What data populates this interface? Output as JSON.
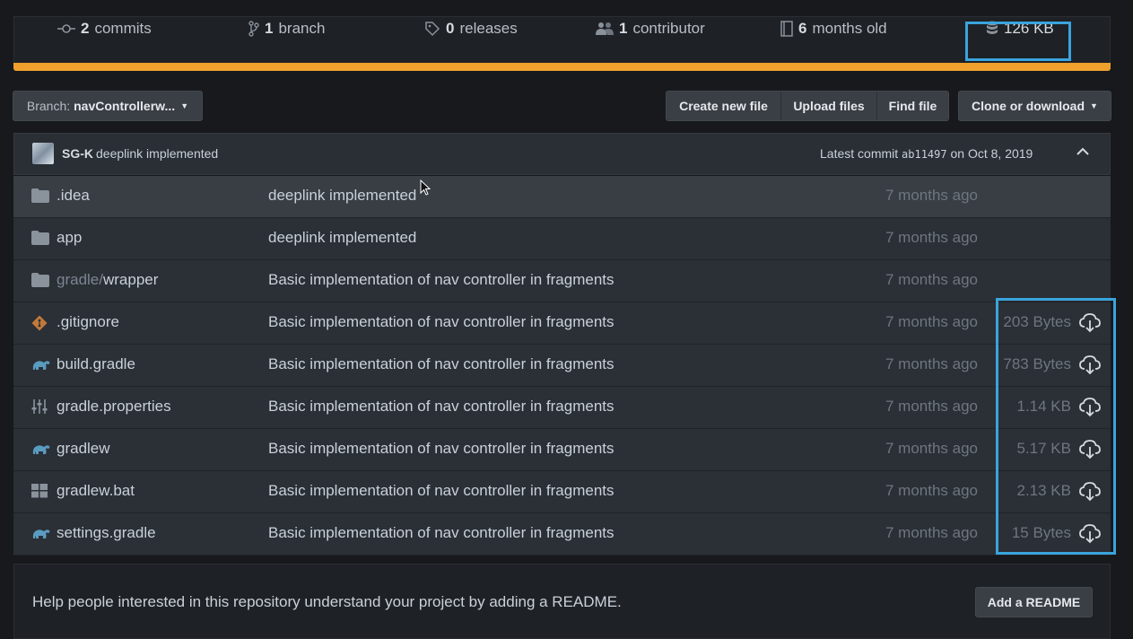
{
  "summary": {
    "commits_count": "2",
    "commits_label": "commits",
    "branch_count": "1",
    "branch_label": "branch",
    "releases_count": "0",
    "releases_label": "releases",
    "contributor_count": "1",
    "contributor_label": "contributor",
    "age_count": "6",
    "age_label": "months old",
    "size": "126 KB"
  },
  "toolbar": {
    "branch_prefix": "Branch:",
    "branch_name": "navControllerw...",
    "create_new_file": "Create new file",
    "upload_files": "Upload files",
    "find_file": "Find file",
    "clone_or_download": "Clone or download"
  },
  "commit": {
    "author": "SG-K",
    "message": "deeplink implemented",
    "latest_label": "Latest commit",
    "sha": "ab11497",
    "date": "on Oct 8, 2019"
  },
  "files": [
    {
      "icon": "folder-icon",
      "name_dim": "",
      "name": ".idea",
      "message": "deeplink implemented",
      "age": "7 months ago",
      "size": ""
    },
    {
      "icon": "folder-icon",
      "name_dim": "",
      "name": "app",
      "message": "deeplink implemented",
      "age": "7 months ago",
      "size": ""
    },
    {
      "icon": "folder-icon",
      "name_dim": "gradle/",
      "name": "wrapper",
      "message": "Basic implementation of nav controller in fragments",
      "age": "7 months ago",
      "size": ""
    },
    {
      "icon": "git-icon",
      "name_dim": "",
      "name": ".gitignore",
      "message": "Basic implementation of nav controller in fragments",
      "age": "7 months ago",
      "size": "203 Bytes"
    },
    {
      "icon": "gradle-icon",
      "name_dim": "",
      "name": "build.gradle",
      "message": "Basic implementation of nav controller in fragments",
      "age": "7 months ago",
      "size": "783 Bytes"
    },
    {
      "icon": "settings-sliders-icon",
      "name_dim": "",
      "name": "gradle.properties",
      "message": "Basic implementation of nav controller in fragments",
      "age": "7 months ago",
      "size": "1.14 KB"
    },
    {
      "icon": "gradle-icon",
      "name_dim": "",
      "name": "gradlew",
      "message": "Basic implementation of nav controller in fragments",
      "age": "7 months ago",
      "size": "5.17 KB"
    },
    {
      "icon": "windows-icon",
      "name_dim": "",
      "name": "gradlew.bat",
      "message": "Basic implementation of nav controller in fragments",
      "age": "7 months ago",
      "size": "2.13 KB"
    },
    {
      "icon": "gradle-icon",
      "name_dim": "",
      "name": "settings.gradle",
      "message": "Basic implementation of nav controller in fragments",
      "age": "7 months ago",
      "size": "15 Bytes"
    }
  ],
  "readme": {
    "text": "Help people interested in this repository understand your project by adding a README.",
    "button": "Add a README"
  },
  "colors": {
    "accent_orange": "#f0a02d",
    "highlight_blue": "#3aa4dc",
    "background": "#17191c"
  }
}
